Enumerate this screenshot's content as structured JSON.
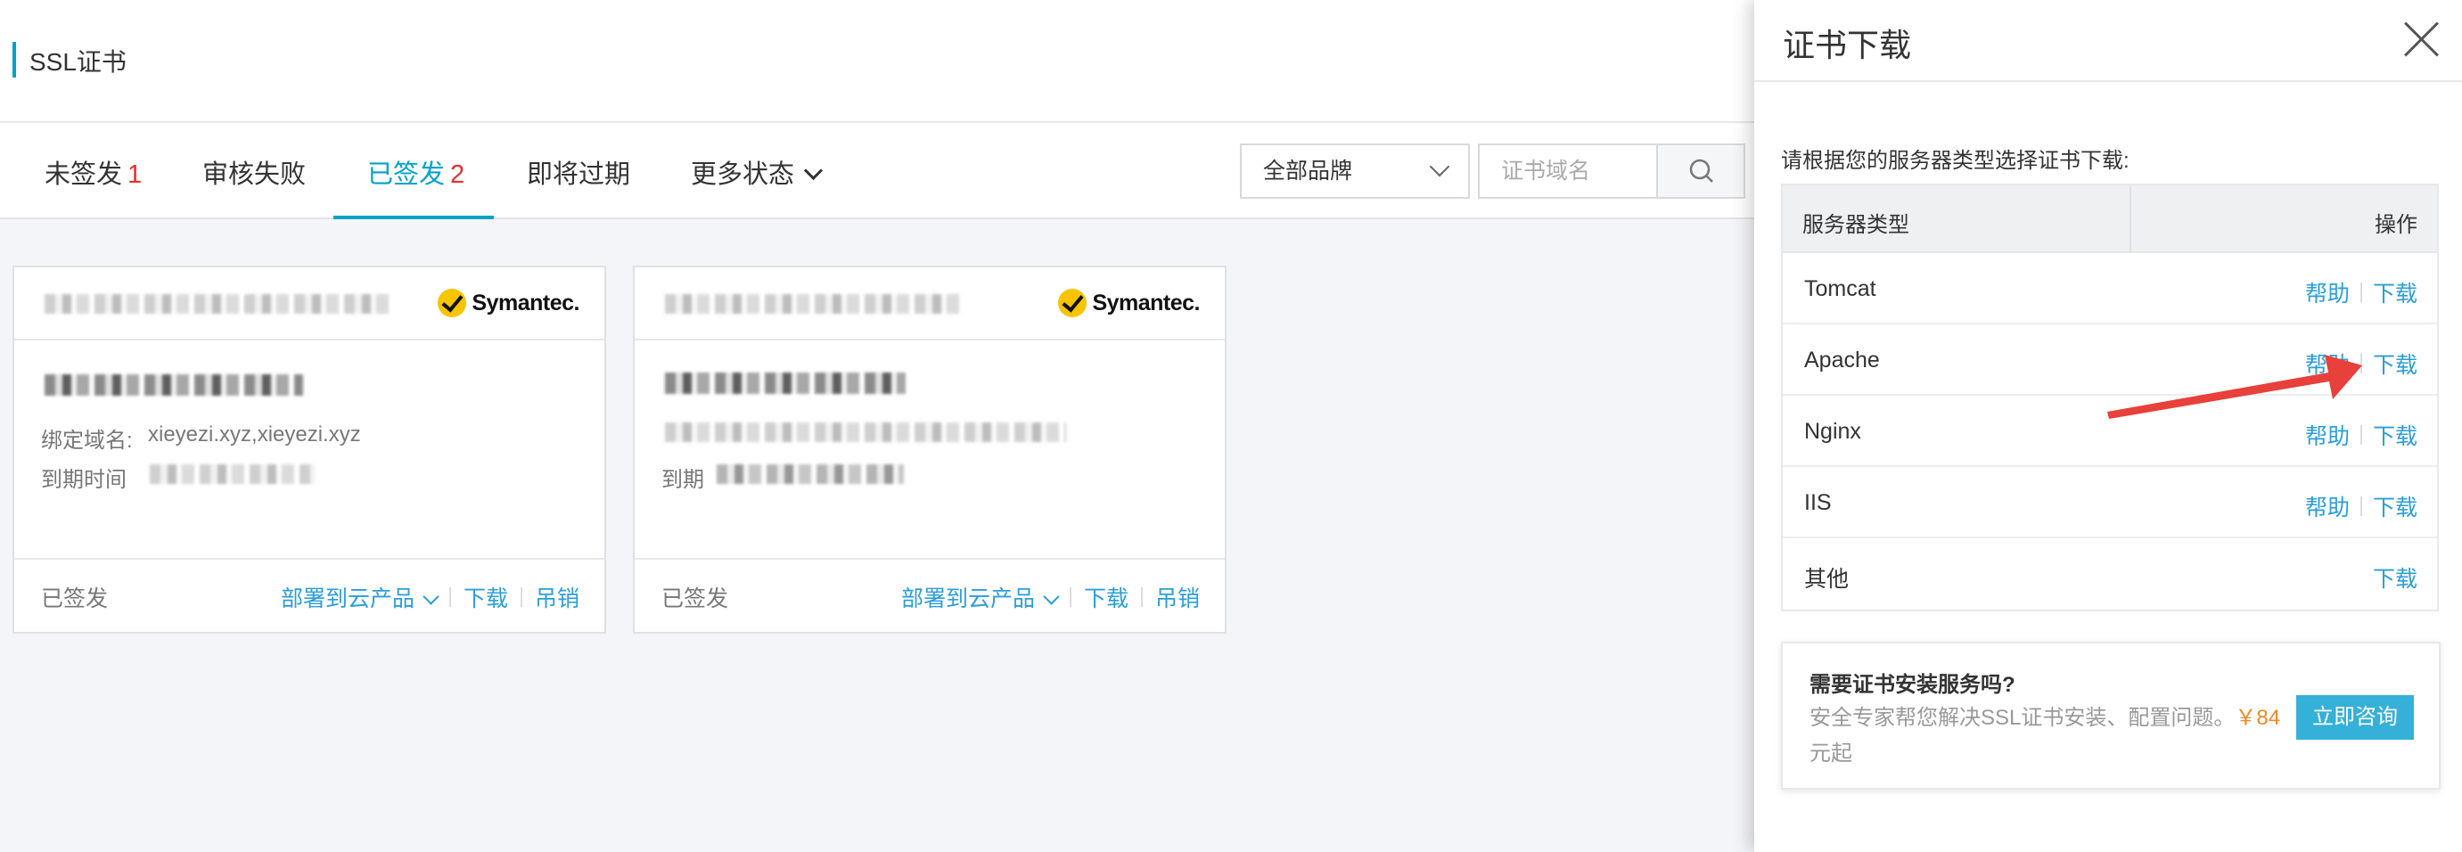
{
  "header": {
    "title": "SSL证书"
  },
  "tabs": [
    {
      "label": "未签发",
      "count": "1"
    },
    {
      "label": "审核失败",
      "count": ""
    },
    {
      "label": "已签发",
      "count": "2"
    },
    {
      "label": "即将过期",
      "count": ""
    },
    {
      "label": "更多状态",
      "count": ""
    }
  ],
  "filters": {
    "brand_selected": "全部品牌",
    "search_placeholder": "证书域名"
  },
  "cards": [
    {
      "brand": "Symantec.",
      "binding_label": "绑定域名:",
      "binding_value": "xieyezi.xyz,xieyezi.xyz",
      "expiry_label": "到期时间",
      "status": "已签发",
      "deploy_label": "部署到云产品",
      "download_label": "下载",
      "revoke_label": "吊销"
    },
    {
      "brand": "Symantec.",
      "expiry_label": "到期",
      "status": "已签发",
      "deploy_label": "部署到云产品",
      "download_label": "下载",
      "revoke_label": "吊销"
    }
  ],
  "drawer": {
    "title": "证书下载",
    "hint": "请根据您的服务器类型选择证书下载:",
    "col_server": "服务器类型",
    "col_action": "操作",
    "rows": [
      {
        "name": "Tomcat",
        "help": "帮助",
        "download": "下载"
      },
      {
        "name": "Apache",
        "help": "帮助",
        "download": "下载"
      },
      {
        "name": "Nginx",
        "help": "帮助",
        "download": "下载"
      },
      {
        "name": "IIS",
        "help": "帮助",
        "download": "下载"
      },
      {
        "name": "其他",
        "download": "下载"
      }
    ],
    "promo": {
      "title": "需要证书安装服务吗?",
      "desc": "安全专家帮您解决SSL证书安装、配置问题。",
      "price": "￥84",
      "suffix": "元起",
      "cta": "立即咨询"
    }
  },
  "colors": {
    "accent": "#00a2ca",
    "link": "#2b9ed8",
    "count_red": "#e5312f",
    "price_orange": "#f08a24",
    "arrow_red": "#e8403a"
  },
  "icons": [
    "search-icon",
    "close-icon",
    "chevron-down-icon",
    "symantec-check-icon"
  ]
}
